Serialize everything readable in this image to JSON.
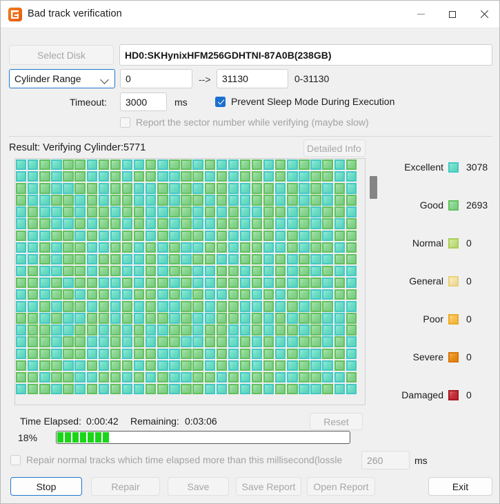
{
  "window": {
    "title": "Bad track verification",
    "icon": "app-logo-icon",
    "minimize": "minimize-icon",
    "maximize": "maximize-icon",
    "close": "close-icon"
  },
  "disk": {
    "select_button": "Select Disk",
    "value": "HD0:SKHynixHFM256GDHTNI-87A0B(238GB)"
  },
  "range": {
    "mode": "Cylinder Range",
    "from": "0",
    "arrow": "-->",
    "to": "31130",
    "bounds": "0-31130"
  },
  "timeout": {
    "label": "Timeout:",
    "value": "3000",
    "unit": "ms"
  },
  "options": {
    "prevent_sleep": "Prevent Sleep Mode During Execution",
    "prevent_sleep_checked": true,
    "report_sector": "Report the sector number while verifying (maybe slow)",
    "report_sector_checked": false
  },
  "result": {
    "text": "Result: Verifying Cylinder:5771",
    "detailed_info_button": "Detailed Info"
  },
  "legend": [
    {
      "name": "Excellent",
      "count": "3078",
      "border": "#43c8c4",
      "fill": "#63dcc2"
    },
    {
      "name": "Good",
      "count": "2693",
      "border": "#63c05e",
      "fill": "#81d48a"
    },
    {
      "name": "Normal",
      "count": "0",
      "border": "#a9cf57",
      "fill": "#c3de7e"
    },
    {
      "name": "General",
      "count": "0",
      "border": "#e8d078",
      "fill": "#f3e2a4"
    },
    {
      "name": "Poor",
      "count": "0",
      "border": "#f0a823",
      "fill": "#f6bd4a"
    },
    {
      "name": "Severe",
      "count": "0",
      "border": "#d97406",
      "fill": "#e8880e"
    },
    {
      "name": "Damaged",
      "count": "0",
      "border": "#a81722",
      "fill": "#c22630"
    }
  ],
  "progress": {
    "time_elapsed_label": "Time Elapsed:",
    "time_elapsed": "0:00:42",
    "remaining_label": "Remaining:",
    "remaining": "0:03:06",
    "reset_button": "Reset",
    "percent_text": "18%",
    "percent_value": 18
  },
  "repair": {
    "label": "Repair normal tracks which time elapsed more than this millisecond(lossle",
    "checked": false,
    "value": "260",
    "unit": "ms"
  },
  "footer": {
    "stop": "Stop",
    "repair": "Repair",
    "save": "Save",
    "save_report": "Save Report",
    "open_report": "Open Report",
    "exit": "Exit"
  },
  "grid": {
    "columns": 29,
    "rows": 20,
    "classes": "exexgdexgdgdexgdgdexexgdexgdgdexgdexexgdgdexgdexgdexgdexgdexexgdexgdgdexexgdexgdgdexexgdgdexgdexgdgdexgdexexgdgdexexgdexgdexexgdgdexgdgdexexgdexgdexgdgdexexgdgdexgdexgdexgdexgdexexgdgdexgdexgdgdexexgdexgdgdexgdexexgdgdexgdexgdexgdgdexgdexexgdexgdgdexgdgdexexgdgdexgdexgdexexgdgdexgdexgdgdexexgdgdexexgdexgdgdexgdexgdexgdexexgdgdexgdgdexexgdexgdexgdgdexexgdgdexgdexexgdgdexgdexgdgdexgdexexgdgdexgdexgdexgdgdexexgdexgdgdexexgdgdexgdexgdexexgdgdexgdgdexexgdexgdgdexgdexexgdexgdgdexgdgdexexgdexgdexgdgdexexgdgdexgdexgdexexgdgdexgdexexgdgdexgdgdexexgdexgdgdexexgdgdexgdexgdexgdexgdexexgdgdexgdexgdgdexexgdexgdgdexgdexexgdgdexgdexgdexgdgdexgdexexgdexgdgdexgdgdexexgdgdexgdexgdexexgdgdexgdexgdgdexexgdgdexexgdexgdgdexgdexgdexgdexexgdgdexgdgdexexgdexgdexgdgdexexgdgdexgdexexgdgdexgdexgdgdexgdexexgdgdexgdexgdexgdgdexexgdexgdgdexexgdgdexgdexgdexexgdgdexgdgdexexgdexgdgdexgdexexgdexgdgdexgdgdexexgdexgdexgdgdexexgdgdexgdexgdexexgdgdexgdexexgdgdexgdgdexexgdexgdgdexexgdgdexgdexgdexgdexgdexexgdgdexgdexgdgdexexgdexgdgdexgdexexgdgdexgdexgdexgdgdexgdexexgdexgdgdexgdgdexexgdgdexgdexgdexexgdgdexgdexgdgdexexgdgdexexgdexgdgdexgdexgdexgdexexgdgdexgdgdexexgdexgdexgdgdexexgd"
  }
}
